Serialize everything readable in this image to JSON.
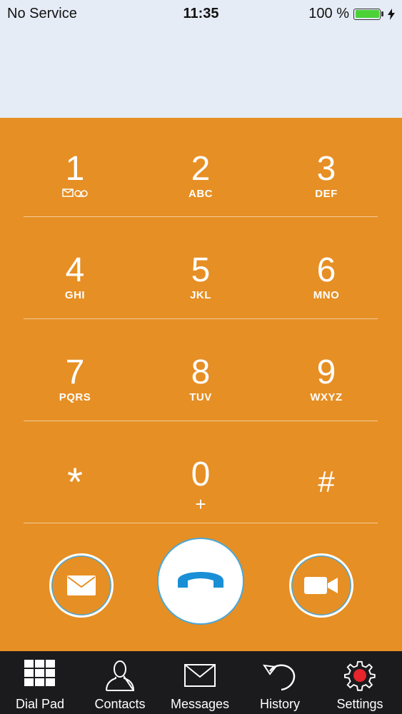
{
  "status_bar": {
    "carrier": "No Service",
    "time": "11:35",
    "battery_percent": "100 %",
    "battery_level": 1.0
  },
  "keypad": {
    "rows": [
      [
        {
          "digit": "1",
          "letters": ""
        },
        {
          "digit": "2",
          "letters": "ABC"
        },
        {
          "digit": "3",
          "letters": "DEF"
        }
      ],
      [
        {
          "digit": "4",
          "letters": "GHI"
        },
        {
          "digit": "5",
          "letters": "JKL"
        },
        {
          "digit": "6",
          "letters": "MNO"
        }
      ],
      [
        {
          "digit": "7",
          "letters": "PQRS"
        },
        {
          "digit": "8",
          "letters": "TUV"
        },
        {
          "digit": "9",
          "letters": "WXYZ"
        }
      ]
    ],
    "bottom_row": {
      "star": "*",
      "zero": "0",
      "zero_sub": "+",
      "hash": "#"
    }
  },
  "actions": {
    "message_icon": "envelope-icon",
    "call_icon": "phone-handset-icon",
    "video_icon": "video-camera-icon"
  },
  "tab_bar": {
    "tabs": [
      {
        "label": "Dial Pad",
        "icon": "dialpad-grid-icon"
      },
      {
        "label": "Contacts",
        "icon": "person-icon"
      },
      {
        "label": "Messages",
        "icon": "envelope-icon"
      },
      {
        "label": "History",
        "icon": "history-arrow-icon"
      },
      {
        "label": "Settings",
        "icon": "gear-icon"
      }
    ]
  },
  "colors": {
    "dial_background": "#e68f24",
    "top_background": "#e6ecf6",
    "accent_blue": "#1a8fd6",
    "tab_bar": "#1b1b1d",
    "settings_dot": "#e8242c"
  }
}
